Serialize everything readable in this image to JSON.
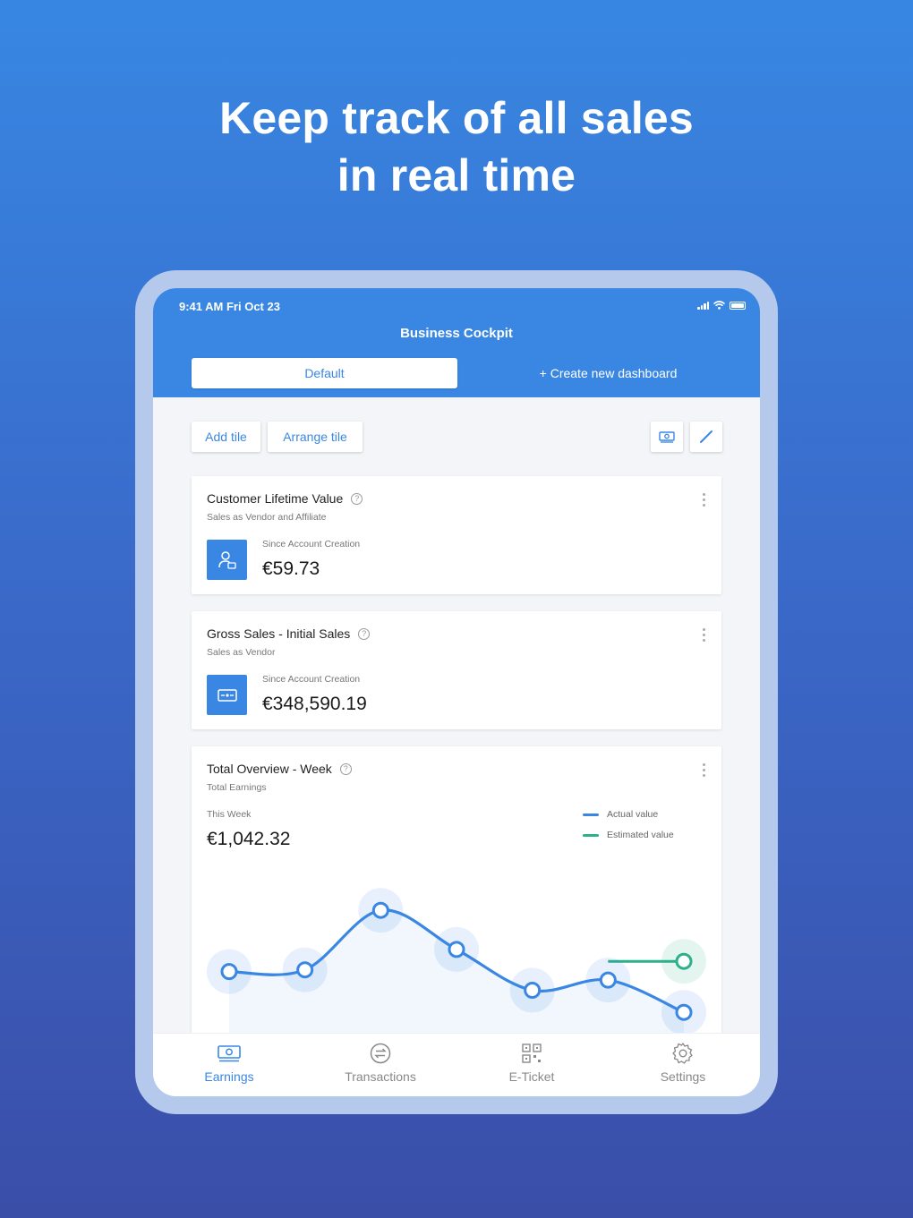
{
  "headline": {
    "line1": "Keep track of all sales",
    "line2": "in real time"
  },
  "status_bar": {
    "time": "9:41 AM   Fri Oct 23"
  },
  "app": {
    "title": "Business Cockpit"
  },
  "tabs": {
    "default_label": "Default",
    "create_label": "+ Create new dashboard"
  },
  "toolbar": {
    "add_tile": "Add tile",
    "arrange_tile": "Arrange tile",
    "icons": [
      "money-icon",
      "pencil-icon"
    ]
  },
  "cards": [
    {
      "title": "Customer Lifetime Value",
      "subtitle": "Sales as Vendor and Affiliate",
      "label": "Since Account Creation",
      "value": "€59.73",
      "icon": "customer-icon"
    },
    {
      "title": "Gross Sales - Initial Sales",
      "subtitle": "Sales as Vendor",
      "label": "Since Account Creation",
      "value": "€348,590.19",
      "icon": "card-icon"
    }
  ],
  "overview": {
    "title": "Total Overview - Week",
    "subtitle": "Total Earnings",
    "period_label": "This Week",
    "value": "€1,042.32",
    "legend": {
      "actual": "Actual value",
      "estimated": "Estimated value"
    }
  },
  "colors": {
    "accent": "#3a87e3",
    "estimated": "#2bb08a",
    "background_top": "#3787e2",
    "background_bottom": "#3a4ea8"
  },
  "chart_data": {
    "type": "line",
    "x": [
      1,
      2,
      3,
      4,
      5,
      6,
      7
    ],
    "series": [
      {
        "name": "Actual value",
        "values": [
          1.8,
          1.85,
          3.6,
          2.45,
          1.25,
          1.55,
          0.6
        ]
      },
      {
        "name": "Estimated value",
        "values": [
          null,
          null,
          null,
          null,
          null,
          2.1,
          2.1
        ]
      }
    ],
    "ylim": [
      0,
      5
    ],
    "grid": false,
    "legend": "top-right"
  },
  "bottom_nav": {
    "items": [
      {
        "label": "Earnings",
        "icon": "earnings-icon",
        "active": true
      },
      {
        "label": "Transactions",
        "icon": "transactions-icon",
        "active": false
      },
      {
        "label": "E-Ticket",
        "icon": "qr-code-icon",
        "active": false
      },
      {
        "label": "Settings",
        "icon": "gear-icon",
        "active": false
      }
    ]
  }
}
